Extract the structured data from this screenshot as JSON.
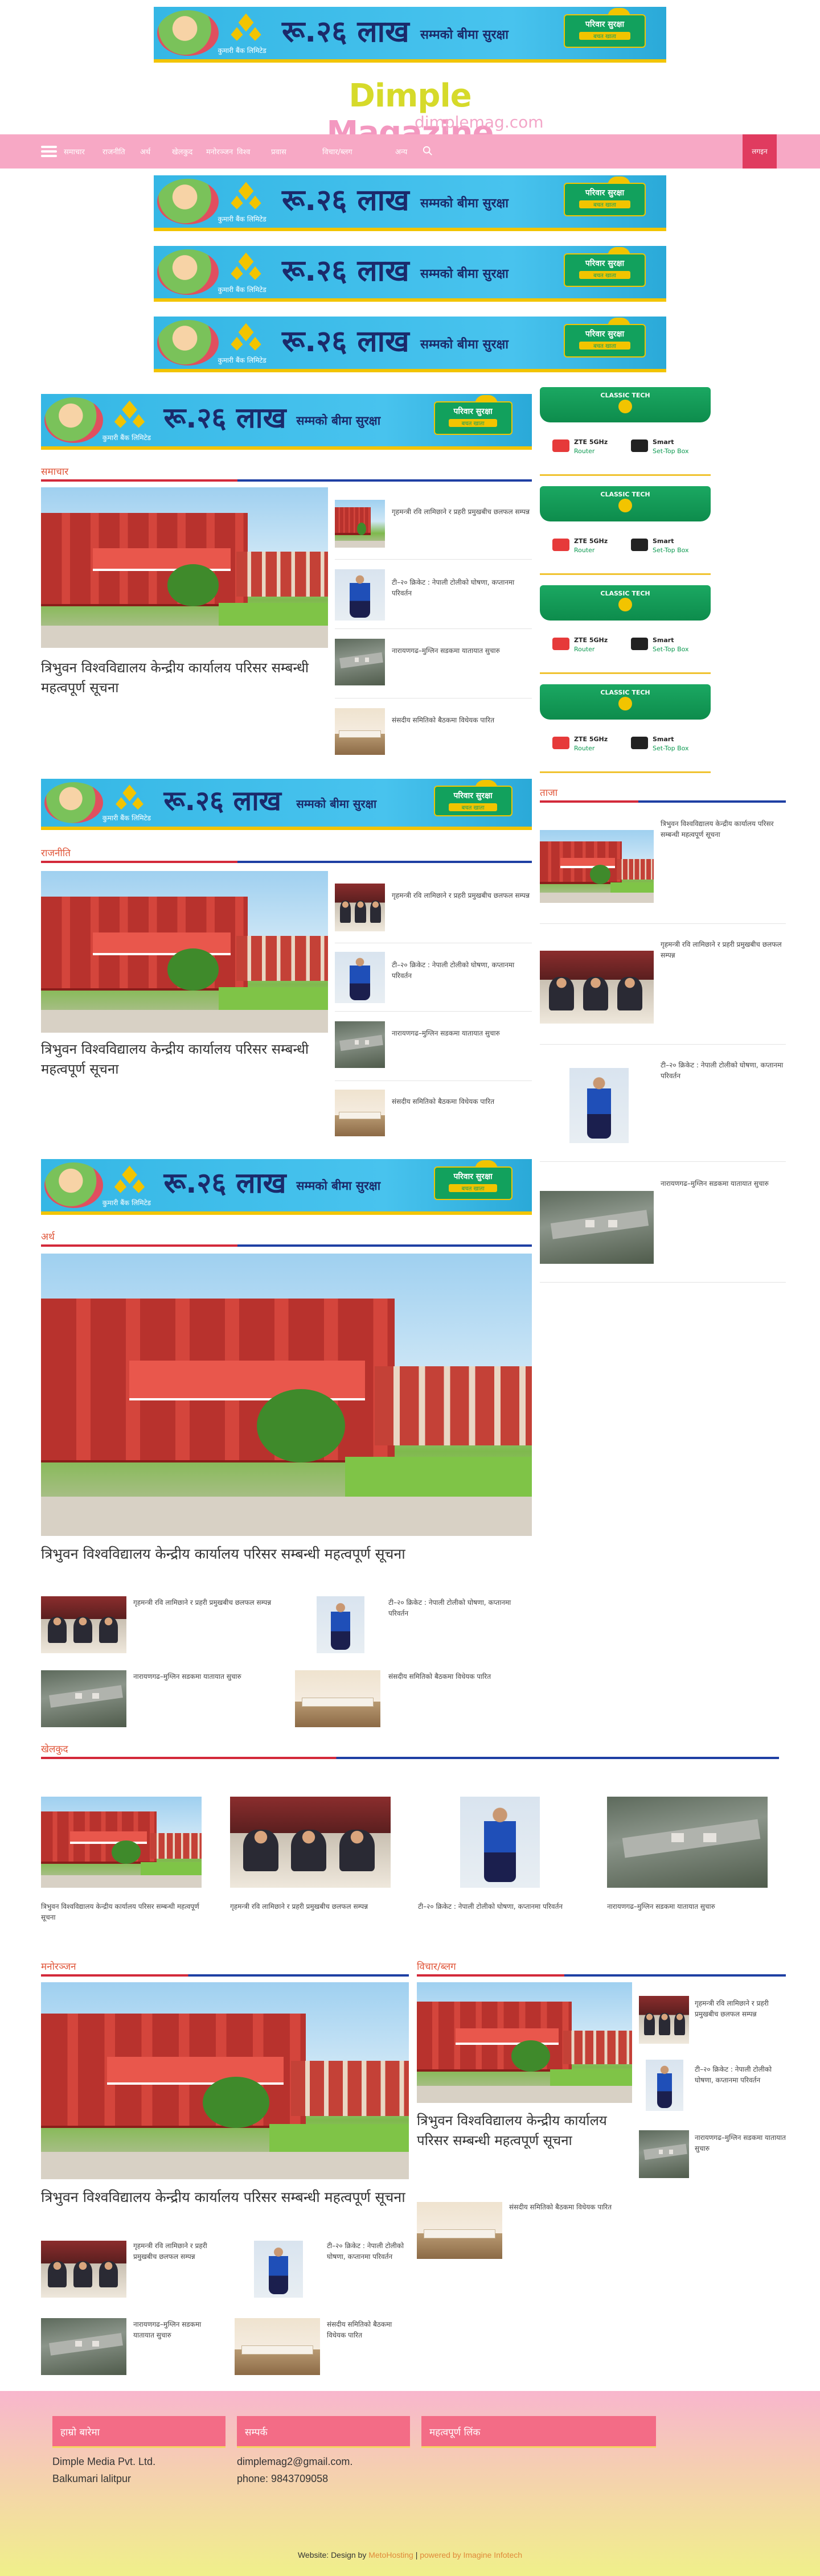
{
  "ad": {
    "company": "कुमारी बैंक लिमिटेड",
    "amount": "रू.२६ लाख",
    "tagline": "सम्मको बीमा सुरक्षा",
    "badge_title": "परिवार सुरक्षा",
    "badge_sub": "बचत खाता"
  },
  "brand": {
    "name_part1": "Dimple",
    "name_part2": "Magazine",
    "domain": "dimplemag.com"
  },
  "nav": {
    "items": [
      "समाचार",
      "राजनीति",
      "अर्थ",
      "खेलकुद",
      "मनोरञ्जन",
      "विश्व",
      "प्रवास",
      "विचार/ब्लग"
    ],
    "button": "लगइन"
  },
  "sections": {
    "s1": "समाचार",
    "s2": "राजनीति",
    "s3": "अर्थ",
    "s4": "खेलकुद",
    "s5": "मनोरञ्जन",
    "s6": "विचार/ब्लग",
    "sidebar": "ताजा"
  },
  "articles": {
    "lead": "त्रिभुवन विश्वविद्यालय केन्द्रीय कार्यालय परिसर सम्बन्धी महत्वपूर्ण सूचना",
    "a1": "गृहमन्त्री रवि लामिछाने र प्रहरी प्रमुखबीच छलफल सम्पन्न",
    "a2": "टी–२० क्रिकेट : नेपाली टोलीको घोषणा, कप्तानमा परिवर्तन",
    "a3": "नारायणगढ–मुग्लिन सडकमा यातायात सुचारु",
    "a4": "संसदीय समितिको बैठकमा विधेयक पारित"
  },
  "gad": {
    "brand": "CLASSIC TECH",
    "item1": "ZTE 5GHz",
    "item1b": "Router",
    "item2": "Smart",
    "item2b": "Set-Top Box"
  },
  "footer": {
    "col1_title": "हाम्रो बारेमा",
    "col2_title": "सम्पर्क",
    "col3_title": "महत्वपूर्ण लिंक",
    "company": "Dimple Media Pvt. Ltd.",
    "address": "Balkumari lalitpur",
    "email": "dimplemag2@gmail.com.",
    "phone": "phone: 9843709058",
    "credit_prefix": "Website: Design by",
    "credit_designer": "MetoHosting",
    "credit_sep": "|",
    "credit_powered": "powered by Imagine Infotech"
  },
  "colors": {
    "nav": "#f7a8c5",
    "accent": "#e03b5f",
    "section_red": "#d3293a",
    "section_blue": "#1e3fa3",
    "ad_green": "#12a15d"
  }
}
